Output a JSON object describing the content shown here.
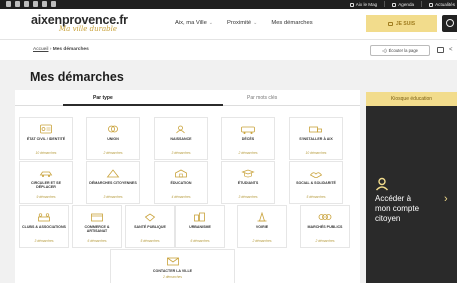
{
  "topbar": {
    "social_icons": [
      "instagram-icon",
      "twitter-icon",
      "camera-icon",
      "youtube-icon",
      "pinterest-icon",
      "flickr-icon"
    ],
    "links": [
      {
        "label": "Aix le Mag",
        "icon": "newspaper-icon"
      },
      {
        "label": "Agenda",
        "icon": "calendar-icon"
      },
      {
        "label": "Actualités",
        "icon": "news-icon"
      }
    ]
  },
  "header": {
    "logo_main": "aixenprovence.fr",
    "logo_sub": "Ma ville durable",
    "nav": [
      "Aix, ma Ville",
      "Proximité",
      "Mes démarches"
    ],
    "jesuis_label": "JE SUIS"
  },
  "crumbs": {
    "home": "Accueil",
    "current": "Mes démarches",
    "listen_label": "Écouter la page"
  },
  "page_title": "Mes démarches",
  "tabs": [
    "Par type",
    "Par mots clés"
  ],
  "tiles": [
    {
      "label": "ÉTAT CIVIL / IDENTITÉ",
      "count": "10 démarches",
      "icon": "id-card-icon"
    },
    {
      "label": "UNION",
      "count": "2 démarches",
      "icon": "rings-icon"
    },
    {
      "label": "NAISSANCE",
      "count": "3 démarches",
      "icon": "baby-icon"
    },
    {
      "label": "DÉCÈS",
      "count": "2 démarches",
      "icon": "hearse-icon"
    },
    {
      "label": "S'INSTALLER À AIX",
      "count": "10 démarches",
      "icon": "moving-truck-icon"
    },
    {
      "label": "CIRCULER ET SE DÉPLACER",
      "count": "9 démarches",
      "icon": "car-icon"
    },
    {
      "label": "DÉMARCHES CITOYENNES",
      "count": "3 démarches",
      "icon": "tent-icon"
    },
    {
      "label": "ÉDUCATION",
      "count": "4 démarches",
      "icon": "school-icon"
    },
    {
      "label": "ÉTUDIANTS",
      "count": "3 démarches",
      "icon": "student-icon"
    },
    {
      "label": "SOCIAL & SOLIDARITÉ",
      "count": "5 démarches",
      "icon": "hands-icon"
    },
    {
      "label": "CLUBS & ASSOCIATIONS",
      "count": "3 démarches",
      "icon": "team-icon"
    },
    {
      "label": "COMMERCE & ARTISANAT",
      "count": "6 démarches",
      "icon": "shop-icon"
    },
    {
      "label": "SANTÉ PUBLIQUE",
      "count": "5 démarches",
      "icon": "health-icon"
    },
    {
      "label": "URBANISME",
      "count": "6 démarches",
      "icon": "city-icon"
    },
    {
      "label": "VOIRIE",
      "count": "2 démarches",
      "icon": "road-cone-icon"
    },
    {
      "label": "MARCHÉS PUBLICS",
      "count": "2 démarches",
      "icon": "contract-icon"
    },
    {
      "label": "CONTACTER LA VILLE",
      "count": "2 démarches",
      "icon": "mail-icon"
    }
  ],
  "sidebar": {
    "tab_label": "Kiosque éducation",
    "account_line1": "Accéder à",
    "account_line2": "mon compte",
    "account_line3": "citoyen"
  },
  "colors": {
    "accent": "#f2dc8c",
    "accent_text": "#a07d1f",
    "dark": "#2a2a2a",
    "topbar": "#1f1f1f"
  }
}
